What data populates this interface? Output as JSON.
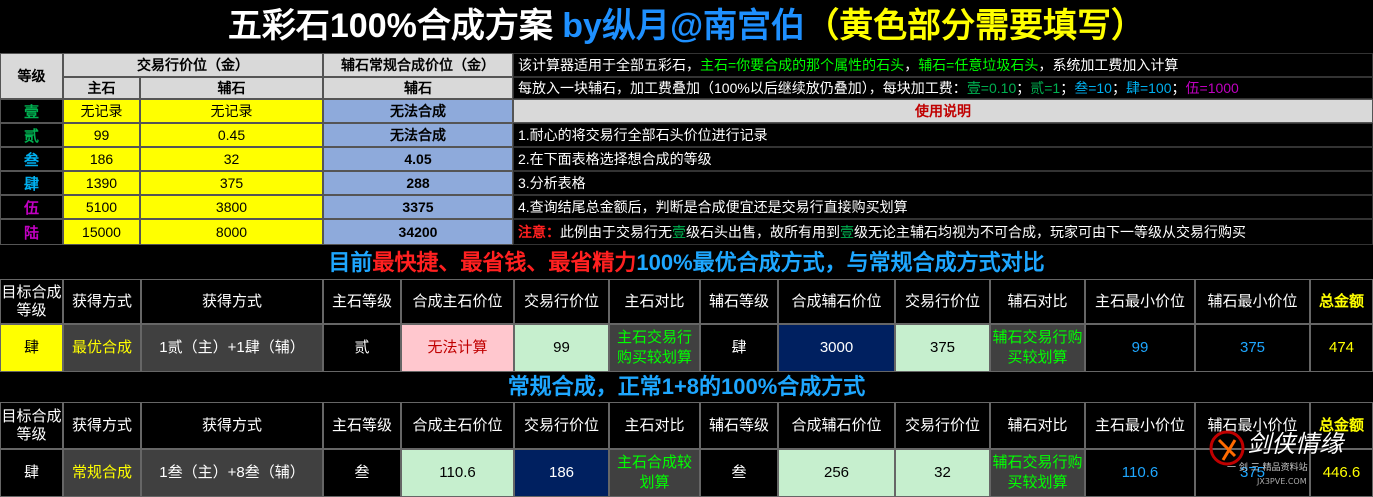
{
  "title": {
    "part1": "五彩石100%合成方案 ",
    "part2": "by纵月@南宫伯",
    "part3": "（黄色部分需要填写）"
  },
  "table1": {
    "h_level": "等级",
    "h_market": "交易行价位（金）",
    "h_aux_conv": "辅石常规合成价位（金）",
    "h_main": "主石",
    "h_aux": "辅石",
    "h_aux2": "辅石",
    "rows": [
      {
        "level": "壹",
        "main": "无记录",
        "aux": "无记录",
        "conv": "无法合成",
        "color": "#00b050"
      },
      {
        "level": "贰",
        "main": "99",
        "aux": "0.45",
        "conv": "无法合成",
        "color": "#00b050"
      },
      {
        "level": "叁",
        "main": "186",
        "aux": "32",
        "conv": "4.05",
        "color": "#00b0f0"
      },
      {
        "level": "肆",
        "main": "1390",
        "aux": "375",
        "conv": "288",
        "color": "#00b0f0"
      },
      {
        "level": "伍",
        "main": "5100",
        "aux": "3800",
        "conv": "3375",
        "color": "#c000c0"
      },
      {
        "level": "陆",
        "main": "15000",
        "aux": "8000",
        "conv": "34200",
        "color": "#c000c0"
      }
    ]
  },
  "notes": {
    "n1a": "该计算器适用于全部五彩石，",
    "n1b": "主石=你要合成的那个属性的石头",
    "n1c": "，",
    "n1d": "辅石=任意垃圾石头",
    "n1e": "，系统加工费加入计算",
    "n2a": "每放入一块辅石，加工费叠加（100%以后继续放仍叠加），每块加工费：",
    "n2b": "壹=0.10",
    "n2c": "；",
    "n2d": "贰=1",
    "n2e": "；",
    "n2f": "叁=10",
    "n2g": "；",
    "n2h": "肆=100",
    "n2i": "；",
    "n2j": "伍=1000",
    "usage": "使用说明",
    "s1": "1.耐心的将交易行全部石头价位进行记录",
    "s2": "2.在下面表格选择想合成的等级",
    "s3": "3.分析表格",
    "s4": "4.查询结尾总金额后，判断是合成便宜还是交易行直接购买划算",
    "s5a": "注意：",
    "s5b": "此例由于交易行无",
    "s5c": "壹",
    "s5d": "级石头出售，故所有用到",
    "s5e": "壹",
    "s5f": "级无论主辅石均视为不可合成，玩家可由下一等级从交易行购买"
  },
  "section1": {
    "a": "目前",
    "b": "最快捷、最省钱、最省精力",
    "c": "100%最优合成方式，与常规合成方式对比"
  },
  "section2": {
    "text": "常规合成，正常1+8的100%合成方式"
  },
  "headers": [
    "目标合成等级",
    "获得方式",
    "获得方式",
    "主石等级",
    "合成主石价位",
    "交易行价位",
    "主石对比",
    "辅石等级",
    "合成辅石价位",
    "交易行价位",
    "辅石对比",
    "主石最小价位",
    "辅石最小价位",
    "总金额"
  ],
  "row1": [
    "肆",
    "最优合成",
    "1贰（主）+1肆（辅）",
    "贰",
    "无法计算",
    "99",
    "主石交易行购买较划算",
    "肆",
    "3000",
    "375",
    "辅石交易行购买较划算",
    "99",
    "375",
    "474"
  ],
  "row2": [
    "肆",
    "常规合成",
    "1叁（主）+8叁（辅）",
    "叁",
    "110.6",
    "186",
    "主石合成较划算",
    "叁",
    "256",
    "32",
    "辅石交易行购买较划算",
    "110.6",
    "375",
    "446.6"
  ],
  "watermark": {
    "logo": "剑侠情缘",
    "sub": "一 剑 三 精品资料站",
    "url": "JX3PVE.COM"
  }
}
